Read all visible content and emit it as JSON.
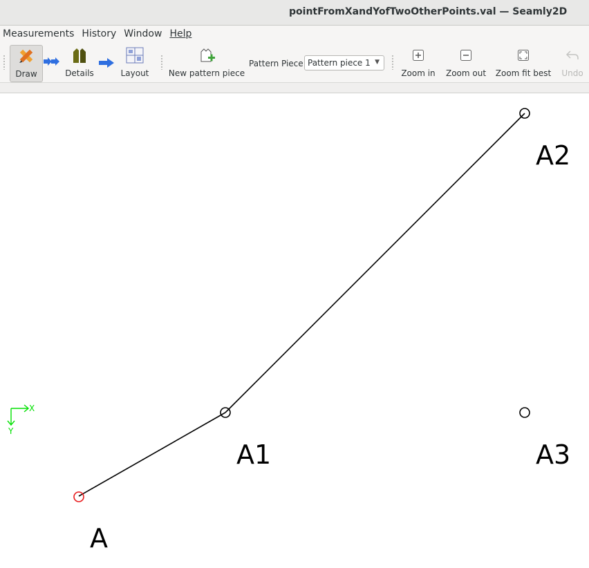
{
  "window": {
    "title": "pointFromXandYofTwoOtherPoints.val — Seamly2D"
  },
  "menu": [
    "Measurements",
    "History",
    "Window",
    "Help"
  ],
  "toolbar": {
    "draw": "Draw",
    "details": "Details",
    "layout": "Layout",
    "new_piece": "New pattern piece",
    "pattern_piece_label": "Pattern Piece:",
    "pattern_piece_value": "Pattern piece 1",
    "zoom_in": "Zoom in",
    "zoom_out": "Zoom out",
    "zoom_fit": "Zoom fit best",
    "undo": "Undo"
  },
  "canvas": {
    "points": {
      "a": "A",
      "a1": "A1",
      "a2": "A2",
      "a3": "A3"
    },
    "axis": {
      "x": "X",
      "y": "Y"
    },
    "colors": {
      "selected_point": "#e8191b",
      "axis": "#00e000",
      "line": "#000000"
    }
  }
}
